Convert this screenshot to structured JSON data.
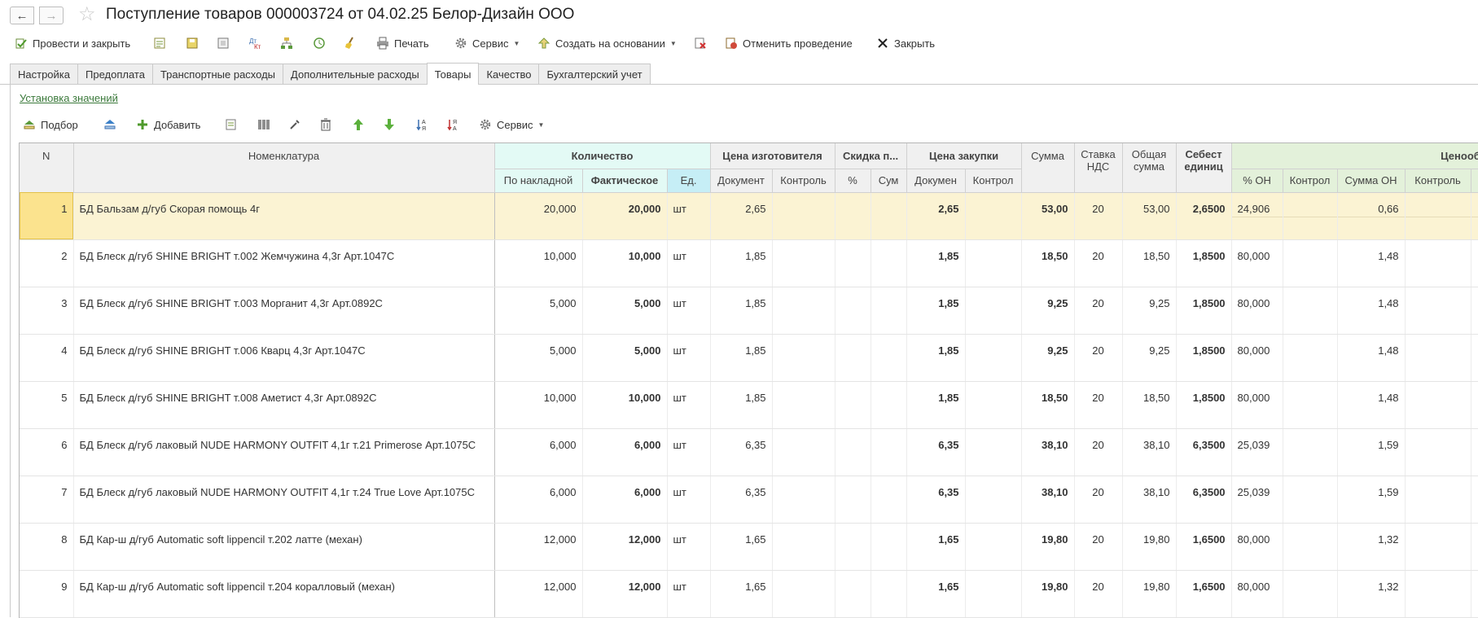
{
  "window": {
    "title": "Поступление товаров 000003724 от 04.02.25 Белор-Дизайн ООО",
    "nav_back": "←",
    "nav_forward": "→",
    "favorite_icon": "star-icon"
  },
  "commands": {
    "post_close": "Провести и закрыть",
    "print": "Печать",
    "service": "Сервис",
    "create_based": "Создать на основании",
    "cancel_posting": "Отменить проведение",
    "close": "Закрыть"
  },
  "tabs": [
    {
      "label": "Настройка"
    },
    {
      "label": "Предоплата"
    },
    {
      "label": "Транспортные расходы"
    },
    {
      "label": "Дополнительные расходы"
    },
    {
      "label": "Товары",
      "active": true
    },
    {
      "label": "Качество"
    },
    {
      "label": "Бухгалтерский учет"
    }
  ],
  "set_values_link": "Установка значений",
  "table_toolbar": {
    "pick": "Подбор",
    "add": "Добавить",
    "service": "Сервис"
  },
  "headers": {
    "n": "N",
    "item": "Номенклатура",
    "qty_group": "Количество",
    "qty_invoice": "По накладной",
    "qty_actual": "Фактическое",
    "unit": "Ед.",
    "mfr_group": "Цена изготовителя",
    "mfr_doc": "Документ",
    "mfr_ctrl": "Контроль",
    "disc_group": "Скидка п...",
    "disc_pct": "%",
    "disc_sum": "Сум",
    "purch_group": "Цена закупки",
    "purch_doc": "Докумен",
    "purch_ctrl": "Контрол",
    "sum": "Сумма",
    "vat": "Ставка НДС",
    "total": "Общая сумма",
    "cost": "Себест единиц",
    "pricing_group": "Ценообраз",
    "pct_on": "% ОН",
    "ctrl1": "Контрол",
    "sum_on": "Сумма ОН",
    "ctrl2": "Контроль"
  },
  "rows": [
    {
      "n": "1",
      "item": "БД Бальзам д/губ Скорая помощь 4г",
      "qty_inv": "20,000",
      "qty_act": "20,000",
      "unit": "шт",
      "mfr_doc": "2,65",
      "purch": "2,65",
      "sum": "53,00",
      "vat": "20",
      "total": "53,00",
      "cost": "2,6500",
      "pct_on": "24,906",
      "sum_on": "0,66"
    },
    {
      "n": "2",
      "item": "БД Блеск д/губ SHINE BRIGHT т.002 Жемчужина 4,3г Арт.1047С",
      "qty_inv": "10,000",
      "qty_act": "10,000",
      "unit": "шт",
      "mfr_doc": "1,85",
      "purch": "1,85",
      "sum": "18,50",
      "vat": "20",
      "total": "18,50",
      "cost": "1,8500",
      "pct_on": "80,000",
      "sum_on": "1,48"
    },
    {
      "n": "3",
      "item": "БД Блеск д/губ SHINE BRIGHT т.003 Морганит 4,3г Арт.0892С",
      "qty_inv": "5,000",
      "qty_act": "5,000",
      "unit": "шт",
      "mfr_doc": "1,85",
      "purch": "1,85",
      "sum": "9,25",
      "vat": "20",
      "total": "9,25",
      "cost": "1,8500",
      "pct_on": "80,000",
      "sum_on": "1,48"
    },
    {
      "n": "4",
      "item": "БД Блеск д/губ SHINE BRIGHT т.006 Кварц 4,3г Арт.1047С",
      "qty_inv": "5,000",
      "qty_act": "5,000",
      "unit": "шт",
      "mfr_doc": "1,85",
      "purch": "1,85",
      "sum": "9,25",
      "vat": "20",
      "total": "9,25",
      "cost": "1,8500",
      "pct_on": "80,000",
      "sum_on": "1,48"
    },
    {
      "n": "5",
      "item": "БД Блеск д/губ SHINE BRIGHT т.008 Аметист 4,3г Арт.0892С",
      "qty_inv": "10,000",
      "qty_act": "10,000",
      "unit": "шт",
      "mfr_doc": "1,85",
      "purch": "1,85",
      "sum": "18,50",
      "vat": "20",
      "total": "18,50",
      "cost": "1,8500",
      "pct_on": "80,000",
      "sum_on": "1,48"
    },
    {
      "n": "6",
      "item": "БД Блеск д/губ лаковый NUDE HARMONY OUTFIT 4,1г т.21  Primerose Арт.1075С",
      "qty_inv": "6,000",
      "qty_act": "6,000",
      "unit": "шт",
      "mfr_doc": "6,35",
      "purch": "6,35",
      "sum": "38,10",
      "vat": "20",
      "total": "38,10",
      "cost": "6,3500",
      "pct_on": "25,039",
      "sum_on": "1,59"
    },
    {
      "n": "7",
      "item": "БД Блеск д/губ лаковый NUDE HARMONY OUTFIT 4,1г т.24 True Love Арт.1075С",
      "qty_inv": "6,000",
      "qty_act": "6,000",
      "unit": "шт",
      "mfr_doc": "6,35",
      "purch": "6,35",
      "sum": "38,10",
      "vat": "20",
      "total": "38,10",
      "cost": "6,3500",
      "pct_on": "25,039",
      "sum_on": "1,59"
    },
    {
      "n": "8",
      "item": "БД Кар-ш д/губ Automatic soft lippencil т.202 латте (механ)",
      "qty_inv": "12,000",
      "qty_act": "12,000",
      "unit": "шт",
      "mfr_doc": "1,65",
      "purch": "1,65",
      "sum": "19,80",
      "vat": "20",
      "total": "19,80",
      "cost": "1,6500",
      "pct_on": "80,000",
      "sum_on": "1,32"
    },
    {
      "n": "9",
      "item": "БД Кар-ш д/губ Automatic soft lippencil т.204 коралловый (механ)",
      "qty_inv": "12,000",
      "qty_act": "12,000",
      "unit": "шт",
      "mfr_doc": "1,65",
      "purch": "1,65",
      "sum": "19,80",
      "vat": "20",
      "total": "19,80",
      "cost": "1,6500",
      "pct_on": "80,000",
      "sum_on": "1,32"
    }
  ]
}
